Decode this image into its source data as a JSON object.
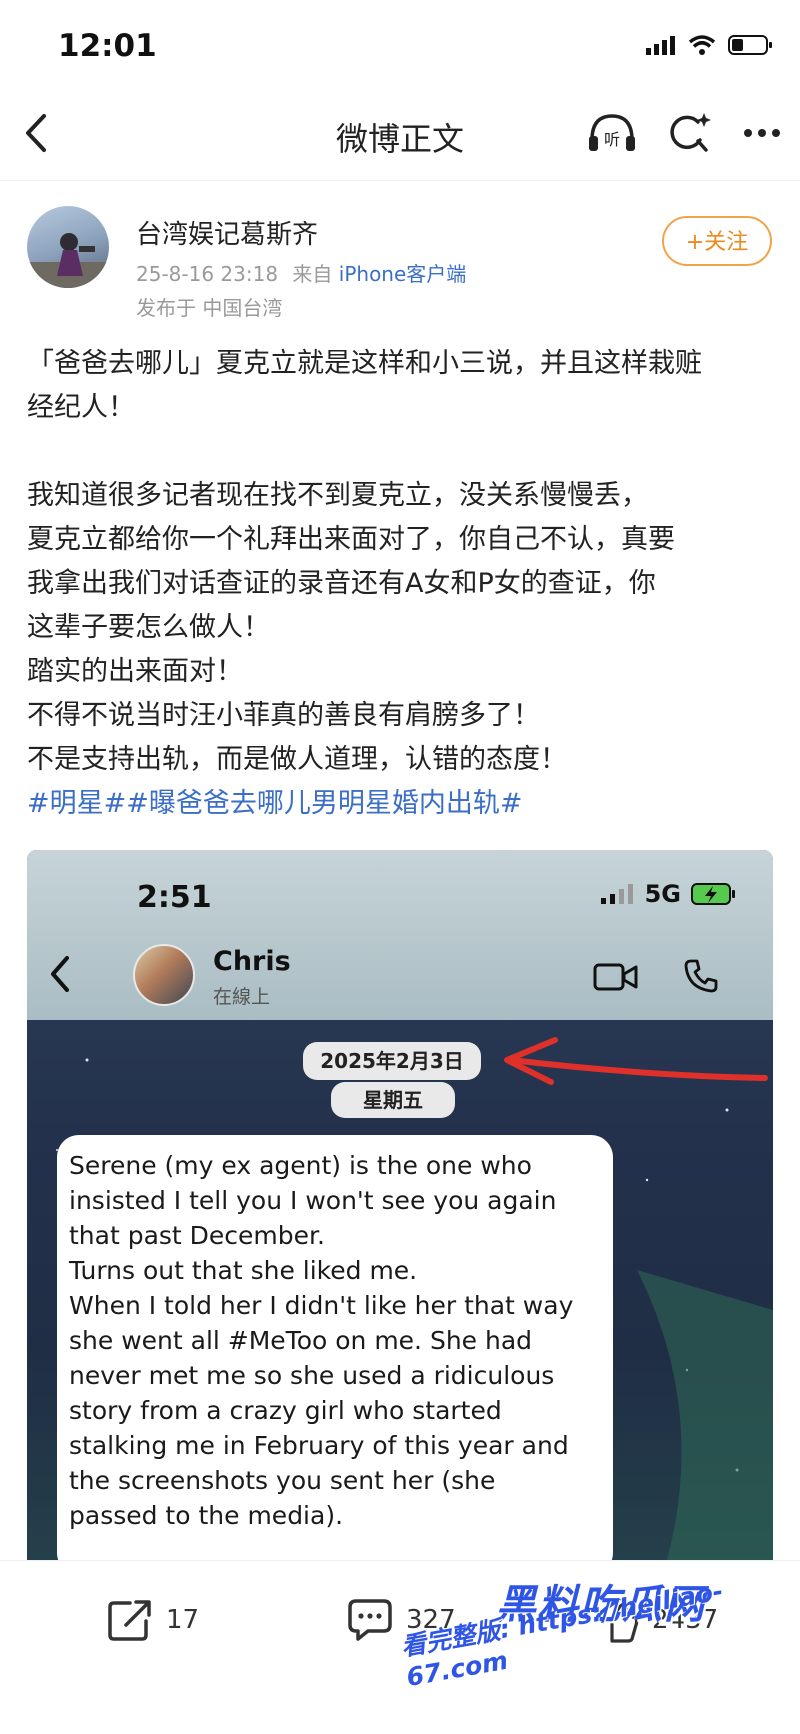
{
  "status_bar": {
    "time": "12:01"
  },
  "header": {
    "title": "微博正文",
    "listen_icon_label": "听"
  },
  "post": {
    "author": "台湾娱记葛斯齐",
    "timestamp": "25-8-16 23:18",
    "source_prefix": "来自",
    "source": "iPhone客户端",
    "location": "发布于 中国台湾",
    "follow_label": "+关注",
    "lines": [
      "「爸爸去哪儿」夏克立就是这样和小三说，并且这样栽赃",
      "经纪人！",
      "",
      "我知道很多记者现在找不到夏克立，没关系慢慢丢，",
      "夏克立都给你一个礼拜出来面对了，你自己不认，真要",
      "我拿出我们对话查证的录音还有A女和P女的查证，你",
      "这辈子要怎么做人！",
      "踏实的出来面对！",
      "不得不说当时汪小菲真的善良有肩膀多了！",
      "不是支持出轨，而是做人道理，认错的态度！"
    ],
    "tags": "#明星##曝爸爸去哪儿男明星婚内出轨#"
  },
  "embedded_screenshot": {
    "time": "2:51",
    "network": "5G",
    "contact_name": "Chris",
    "contact_status": "在線上",
    "date": "2025年2月3日",
    "weekday": "星期五",
    "message_lines": [
      "Serene (my ex agent) is the one who",
      "insisted I tell you I won't see you again",
      "that past December.",
      "Turns out that she liked me.",
      "When I told her I didn't like her that way",
      "she went all #MeToo on me. She had",
      "never met me so she used a ridiculous",
      "story from a crazy girl who started",
      "stalking me in February of this year and",
      "the screenshots you sent her (she",
      "passed to the media)."
    ]
  },
  "actions": {
    "share_count": "17",
    "comment_count": "327",
    "like_count": "2437"
  },
  "watermark": {
    "brand": "黑料吃瓜网",
    "url_line": "看完整版: https://heiliao-67.com"
  },
  "colors": {
    "accent_link": "#3b6ec7",
    "follow_orange": "#ec8a20",
    "watermark_blue": "#2f55e6"
  }
}
